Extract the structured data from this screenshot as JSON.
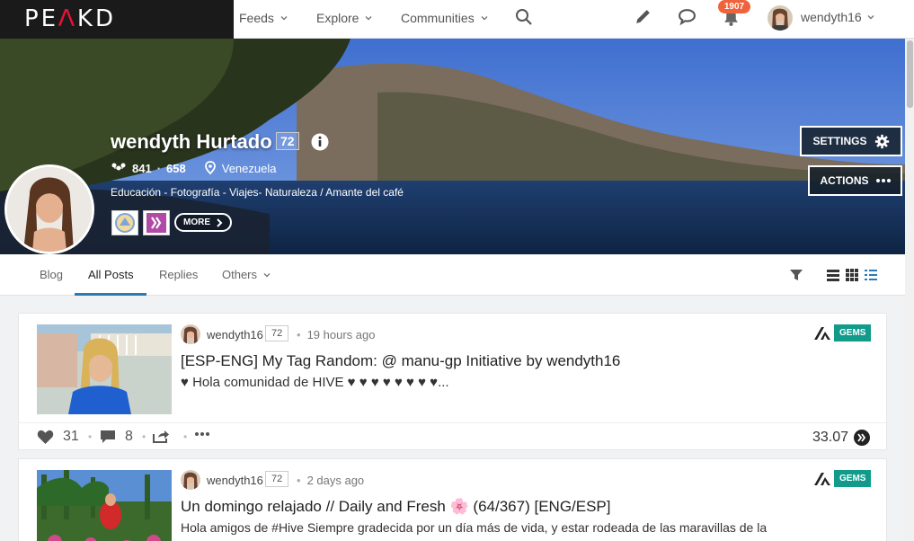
{
  "app": {
    "logo": "PEAKD"
  },
  "nav": {
    "items": [
      {
        "label": "Feeds"
      },
      {
        "label": "Explore"
      },
      {
        "label": "Communities"
      }
    ],
    "notifications_count": "1907",
    "username": "wendyth16"
  },
  "profile": {
    "name": "wendyth Hurtado",
    "reputation": "72",
    "followers": "841",
    "following": "658",
    "location": "Venezuela",
    "bio": "Educación - Fotografía - Viajes- Naturaleza / Amante del café",
    "more_label": "MORE",
    "settings_label": "SETTINGS",
    "actions_label": "ACTIONS"
  },
  "tabs": [
    {
      "label": "Blog"
    },
    {
      "label": "All Posts"
    },
    {
      "label": "Replies"
    },
    {
      "label": "Others"
    }
  ],
  "posts": [
    {
      "author": "wendyth16",
      "reputation": "72",
      "time": "19 hours ago",
      "community_badge": "GEMS",
      "title": "[ESP-ENG] My Tag Random: @ manu-gp Initiative by wendyth16",
      "excerpt": "♥ Hola comunidad de HIVE ♥ ♥ ♥ ♥ ♥ ♥ ♥ ♥...",
      "votes": "31",
      "comments": "8",
      "payout": "33.07"
    },
    {
      "author": "wendyth16",
      "reputation": "72",
      "time": "2 days ago",
      "community_badge": "GEMS",
      "title": "Un domingo relajado // Daily and Fresh 🌸 (64/367) [ENG/ESP]",
      "excerpt": "Hola amigos de #Hive Siempre gradecida por un día más de vida, y estar rodeada de las maravillas de la"
    }
  ],
  "colors": {
    "brand_red": "#e31337",
    "notification": "#f0623a",
    "gems": "#129b8a",
    "tab_active": "#2a7ab8"
  }
}
